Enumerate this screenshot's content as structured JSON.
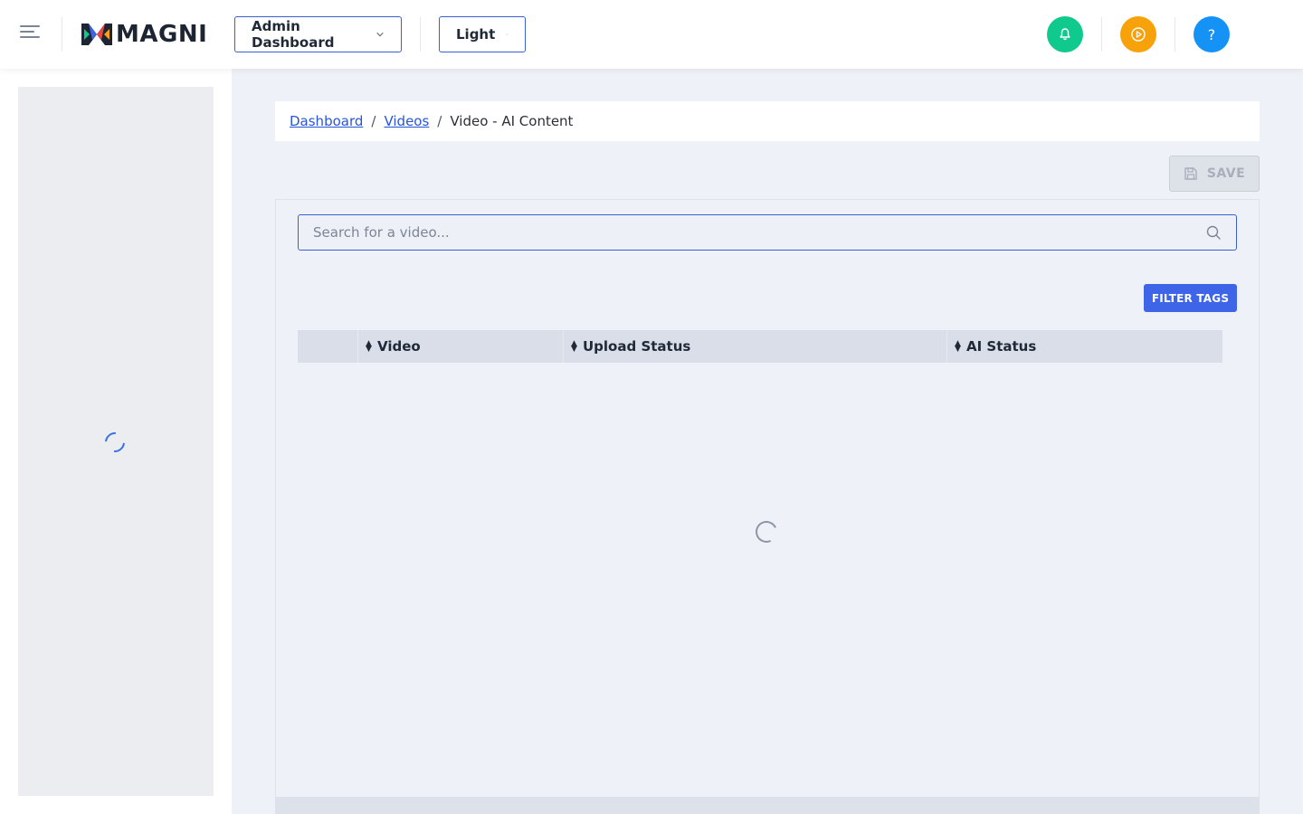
{
  "header": {
    "brand": "MAGNI",
    "dashboard_select": "Admin Dashboard",
    "theme_select": "Light",
    "help_label": "?"
  },
  "breadcrumb": {
    "items": [
      "Dashboard",
      "Videos"
    ],
    "current": "Video - AI Content"
  },
  "toolbar": {
    "save_label": "SAVE"
  },
  "search": {
    "placeholder": "Search for a video..."
  },
  "filter": {
    "label": "FILTER TAGS"
  },
  "table": {
    "columns": [
      "",
      "Video",
      "Upload Status",
      "AI Status"
    ]
  },
  "colors": {
    "accent": "#3e64e8",
    "notify": "#10c98c",
    "media": "#f7a20b",
    "help": "#1592f6"
  }
}
